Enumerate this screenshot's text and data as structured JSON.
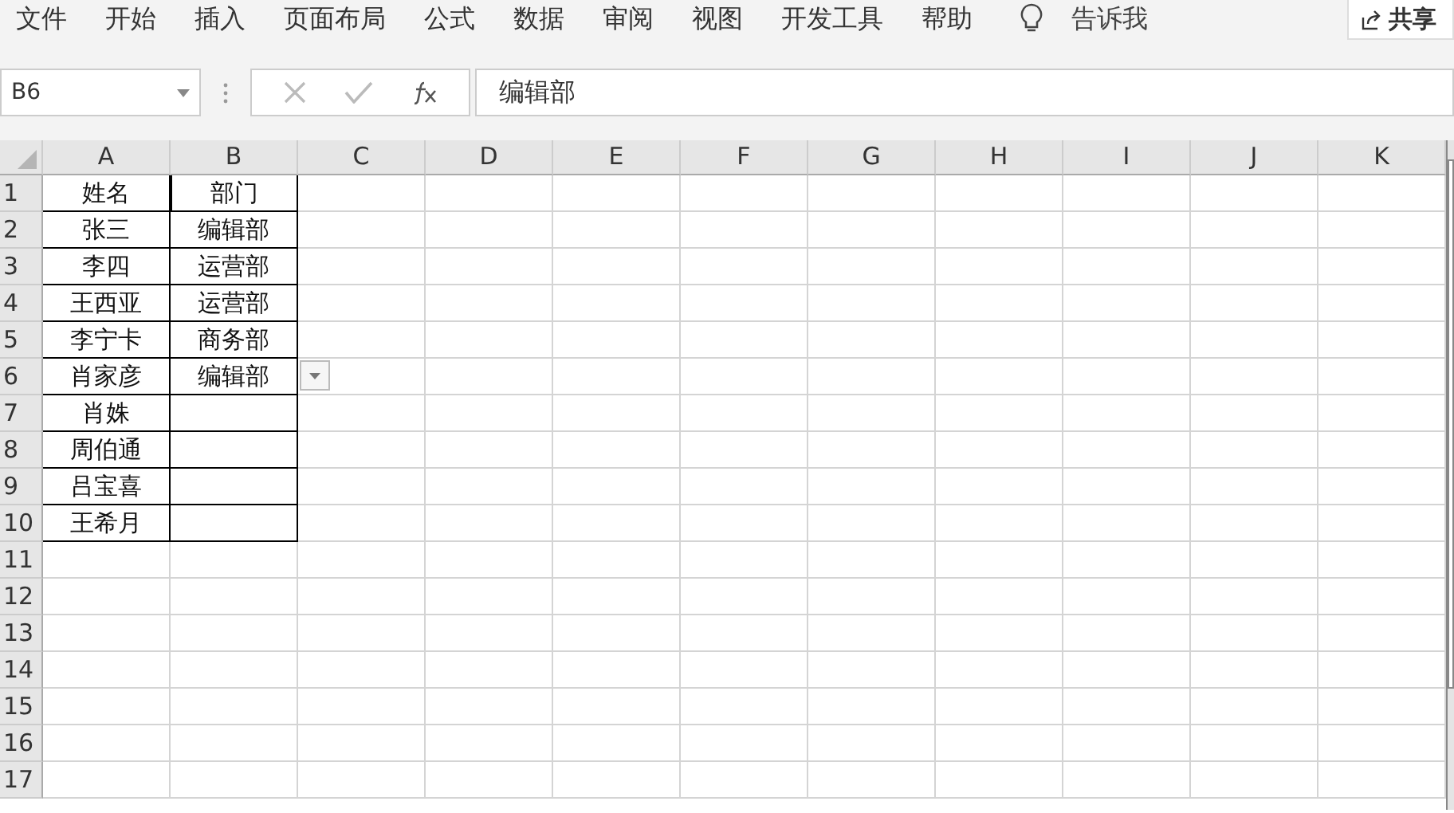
{
  "menu": {
    "items": [
      "文件",
      "开始",
      "插入",
      "页面布局",
      "公式",
      "数据",
      "审阅",
      "视图",
      "开发工具",
      "帮助"
    ],
    "tell_me": "告诉我",
    "share": "共享"
  },
  "formula_bar": {
    "name_box": "B6",
    "formula": "编辑部"
  },
  "columns": [
    "A",
    "B",
    "C",
    "D",
    "E",
    "F",
    "G",
    "H",
    "I",
    "J",
    "K"
  ],
  "rows": [
    {
      "number": "1",
      "bordered": true,
      "dropdown": false,
      "cells": [
        "姓名",
        "部门"
      ]
    },
    {
      "number": "2",
      "bordered": true,
      "dropdown": false,
      "cells": [
        "张三",
        "编辑部"
      ]
    },
    {
      "number": "3",
      "bordered": true,
      "dropdown": false,
      "cells": [
        "李四",
        "运营部"
      ]
    },
    {
      "number": "4",
      "bordered": true,
      "dropdown": false,
      "cells": [
        "王西亚",
        "运营部"
      ]
    },
    {
      "number": "5",
      "bordered": true,
      "dropdown": false,
      "cells": [
        "李宁卡",
        "商务部"
      ]
    },
    {
      "number": "6",
      "bordered": true,
      "dropdown": true,
      "cells": [
        "肖家彦",
        "编辑部"
      ]
    },
    {
      "number": "7",
      "bordered": true,
      "dropdown": false,
      "cells": [
        "肖姝"
      ]
    },
    {
      "number": "8",
      "bordered": true,
      "dropdown": false,
      "cells": [
        "周伯通"
      ]
    },
    {
      "number": "9",
      "bordered": true,
      "dropdown": false,
      "cells": [
        "吕宝喜"
      ]
    },
    {
      "number": "10",
      "bordered": true,
      "dropdown": false,
      "cells": [
        "王希月"
      ]
    },
    {
      "number": "11",
      "bordered": false,
      "dropdown": false,
      "cells": []
    },
    {
      "number": "12",
      "bordered": false,
      "dropdown": false,
      "cells": []
    },
    {
      "number": "13",
      "bordered": false,
      "dropdown": false,
      "cells": []
    },
    {
      "number": "14",
      "bordered": false,
      "dropdown": false,
      "cells": []
    },
    {
      "number": "15",
      "bordered": false,
      "dropdown": false,
      "cells": []
    },
    {
      "number": "16",
      "bordered": false,
      "dropdown": false,
      "cells": []
    },
    {
      "number": "17",
      "bordered": false,
      "dropdown": false,
      "cells": []
    }
  ]
}
